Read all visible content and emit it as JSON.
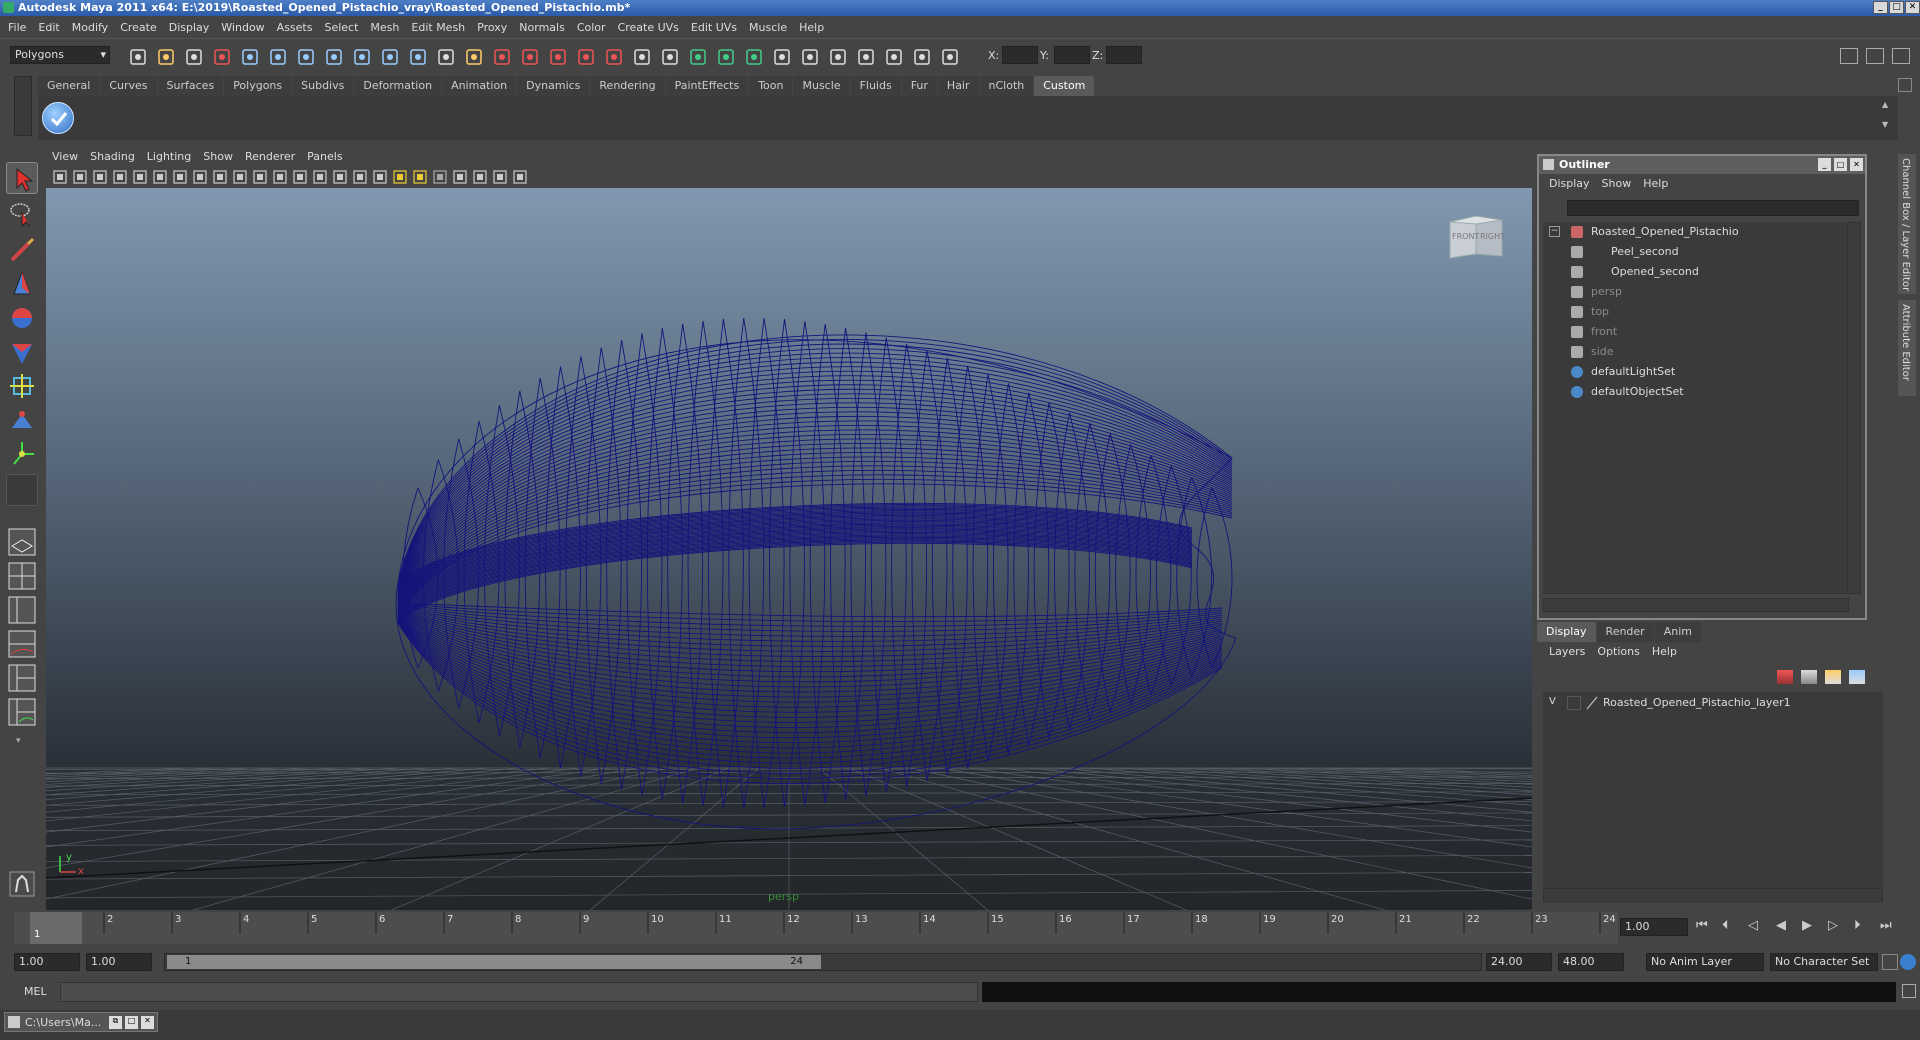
{
  "window": {
    "title": "Autodesk Maya 2011 x64: E:\\2019\\Roasted_Opened_Pistachio_vray\\Roasted_Opened_Pistachio.mb*"
  },
  "menubar": [
    "File",
    "Edit",
    "Modify",
    "Create",
    "Display",
    "Window",
    "Assets",
    "Select",
    "Mesh",
    "Edit Mesh",
    "Proxy",
    "Normals",
    "Color",
    "Create UVs",
    "Edit UVs",
    "Muscle",
    "Help"
  ],
  "statusline": {
    "mode_select": "Polygons",
    "x_label": "X:",
    "y_label": "Y:",
    "z_label": "Z:"
  },
  "shelf_tabs": [
    "General",
    "Curves",
    "Surfaces",
    "Polygons",
    "Subdivs",
    "Deformation",
    "Animation",
    "Dynamics",
    "Rendering",
    "PaintEffects",
    "Toon",
    "Muscle",
    "Fluids",
    "Fur",
    "Hair",
    "nCloth",
    "Custom"
  ],
  "shelf_active_tab": "Custom",
  "viewport": {
    "menu": [
      "View",
      "Shading",
      "Lighting",
      "Show",
      "Renderer",
      "Panels"
    ],
    "camera_label": "persp",
    "viewcube_front": "FRONT",
    "viewcube_right": "RIGHT",
    "axis_x": "x",
    "axis_y": "y"
  },
  "outliner": {
    "title": "Outliner",
    "menu": [
      "Display",
      "Show",
      "Help"
    ],
    "items": [
      {
        "label": "Roasted_Opened_Pistachio",
        "dim": false
      },
      {
        "label": "Peel_second",
        "dim": false
      },
      {
        "label": "Opened_second",
        "dim": false
      },
      {
        "label": "persp",
        "dim": true
      },
      {
        "label": "top",
        "dim": true
      },
      {
        "label": "front",
        "dim": true
      },
      {
        "label": "side",
        "dim": true
      },
      {
        "label": "defaultLightSet",
        "dim": false
      },
      {
        "label": "defaultObjectSet",
        "dim": false
      }
    ]
  },
  "layer_editor": {
    "tabs": [
      "Display",
      "Render",
      "Anim"
    ],
    "active_tab": "Display",
    "menu": [
      "Layers",
      "Options",
      "Help"
    ],
    "layer_visibility": "V",
    "layer_name": "Roasted_Opened_Pistachio_layer1"
  },
  "side_tabs": [
    "Channel Box / Layer Editor",
    "Attribute Editor"
  ],
  "timeline": {
    "ticks": [
      "1",
      "2",
      "3",
      "4",
      "5",
      "6",
      "7",
      "8",
      "9",
      "10",
      "11",
      "12",
      "13",
      "14",
      "15",
      "16",
      "17",
      "18",
      "19",
      "20",
      "21",
      "22",
      "23",
      "24"
    ],
    "current_frame_marker": "1",
    "current_time": "1.00"
  },
  "range": {
    "start_time": "1.00",
    "playback_start": "1.00",
    "slider_start": "1",
    "slider_end": "24",
    "playback_end": "24.00",
    "end_time": "48.00",
    "anim_layer": "No Anim Layer",
    "character_set": "No Character Set"
  },
  "commandline": {
    "label": "MEL"
  },
  "taskbar": {
    "item": "C:\\Users\\Ma..."
  },
  "colors": {
    "wireframe": "#14147a",
    "ui_bg": "#444444",
    "title_blue": "#2b5aa8"
  }
}
